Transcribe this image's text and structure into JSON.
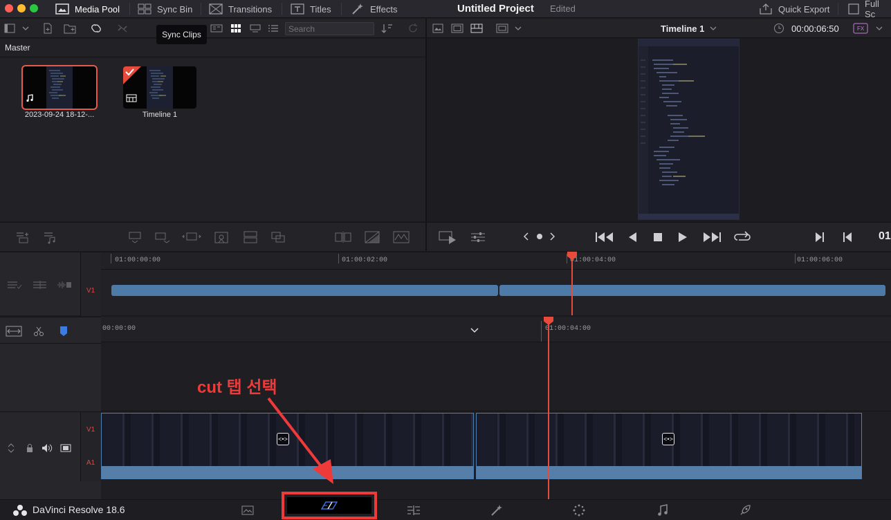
{
  "topbar": {
    "media_pool": "Media Pool",
    "sync_bin": "Sync Bin",
    "transitions": "Transitions",
    "titles": "Titles",
    "effects": "Effects",
    "project_title": "Untitled Project",
    "project_status": "Edited",
    "quick_export": "Quick Export",
    "full_screen": "Full Sc"
  },
  "media_pool": {
    "tooltip": "Sync Clips",
    "search_placeholder": "Search",
    "bin_name": "Master",
    "clips": [
      {
        "name": "2023-09-24 18-12-...",
        "icon": "music-icon",
        "selected": true
      },
      {
        "name": "Timeline 1",
        "icon": "timeline-icon",
        "selected": false
      }
    ]
  },
  "viewer": {
    "timeline_name": "Timeline 1",
    "timecode": "00:00:06:50",
    "timecode_right": "01"
  },
  "upper_timeline": {
    "ruler": [
      "01:00:00:00",
      "01:00:02:00",
      "01:00:04:00",
      "01:00:06:00"
    ],
    "track_label": "V1"
  },
  "lower_timeline": {
    "ruler": [
      "00:00:00",
      "01:00:04:00"
    ],
    "track_labels": {
      "video": "V1",
      "audio": "A1"
    }
  },
  "annotation": {
    "text": "cut 탭 선택"
  },
  "bottombar": {
    "app_name": "DaVinci Resolve 18.6"
  },
  "colors": {
    "accent_red": "#e64b3c",
    "clip_blue": "#4d7aa6",
    "annotation_red": "#ef3a3a"
  }
}
